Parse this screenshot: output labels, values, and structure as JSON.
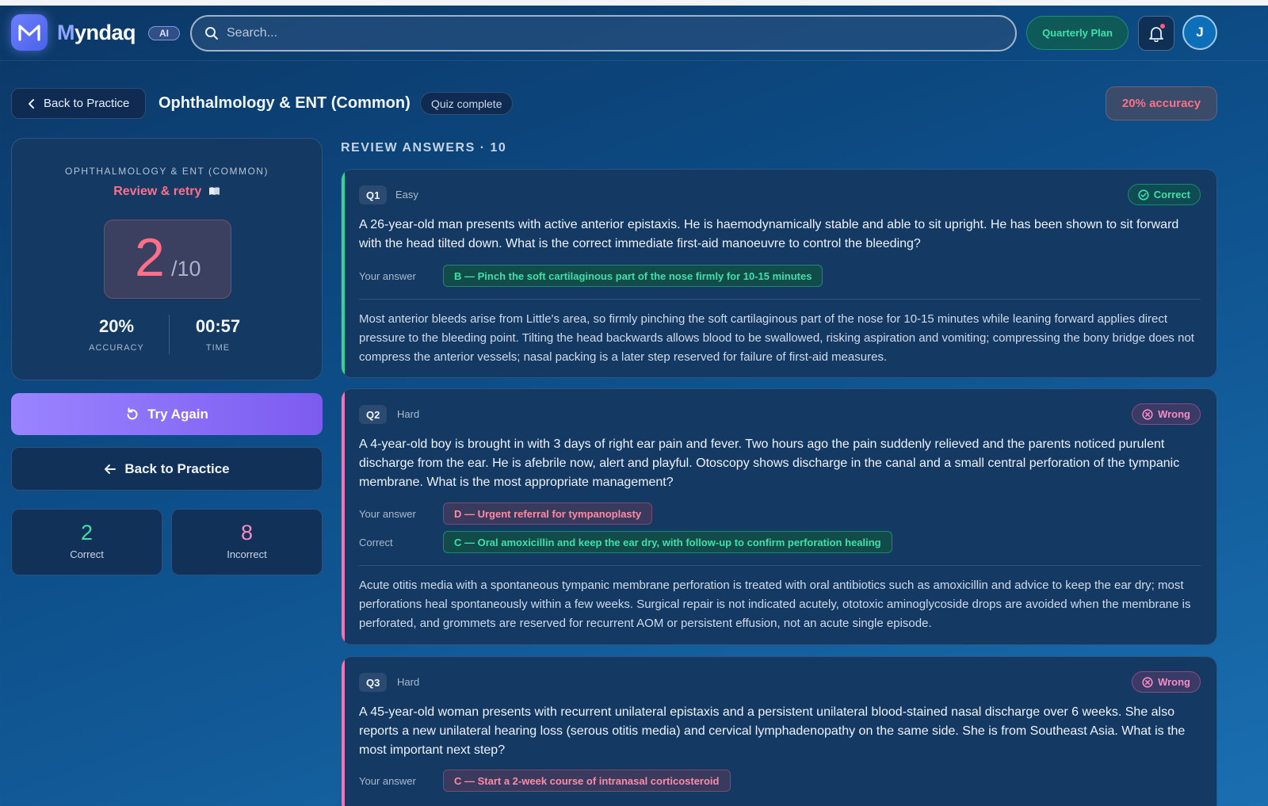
{
  "header": {
    "brand_first": "M",
    "brand_rest": "yndaq",
    "ai_badge": "AI",
    "search_placeholder": "Search...",
    "plan_label": "Quarterly Plan",
    "avatar_initial": "J"
  },
  "subheader": {
    "back_label": "Back to Practice",
    "title": "Ophthalmology & ENT (Common)",
    "status_badge": "Quiz complete",
    "accuracy_badge": "20% accuracy"
  },
  "score_card": {
    "category": "OPHTHALMOLOGY & ENT (COMMON)",
    "subtitle": "Review & retry",
    "score": "2",
    "total": "/10",
    "accuracy_value": "20%",
    "accuracy_label": "ACCURACY",
    "time_value": "00:57",
    "time_label": "TIME"
  },
  "actions": {
    "try_again": "Try Again",
    "back_to_practice": "Back to Practice"
  },
  "tallies": {
    "correct_value": "2",
    "correct_label": "Correct",
    "incorrect_value": "8",
    "incorrect_label": "Incorrect"
  },
  "review": {
    "heading": "REVIEW ANSWERS · 10",
    "your_answer_label": "Your answer",
    "correct_label": "Correct",
    "questions": [
      {
        "num": "Q1",
        "difficulty": "Easy",
        "status": "Correct",
        "text": "A 26-year-old man presents with active anterior epistaxis. He is haemodynamically stable and able to sit upright. He has been shown to sit forward with the head tilted down. What is the correct immediate first-aid manoeuvre to control the bleeding?",
        "your_answer": "B — Pinch the soft cartilaginous part of the nose firmly for 10-15 minutes",
        "explanation": "Most anterior bleeds arise from Little's area, so firmly pinching the soft cartilaginous part of the nose for 10-15 minutes while leaning forward applies direct pressure to the bleeding point. Tilting the head backwards allows blood to be swallowed, risking aspiration and vomiting; compressing the bony bridge does not compress the anterior vessels; nasal packing is a later step reserved for failure of first-aid measures."
      },
      {
        "num": "Q2",
        "difficulty": "Hard",
        "status": "Wrong",
        "text": "A 4-year-old boy is brought in with 3 days of right ear pain and fever. Two hours ago the pain suddenly relieved and the parents noticed purulent discharge from the ear. He is afebrile now, alert and playful. Otoscopy shows discharge in the canal and a small central perforation of the tympanic membrane. What is the most appropriate management?",
        "your_answer": "D — Urgent referral for tympanoplasty",
        "correct_answer": "C — Oral amoxicillin and keep the ear dry, with follow-up to confirm perforation healing",
        "explanation": "Acute otitis media with a spontaneous tympanic membrane perforation is treated with oral antibiotics such as amoxicillin and advice to keep the ear dry; most perforations heal spontaneously within a few weeks. Surgical repair is not indicated acutely, ototoxic aminoglycoside drops are avoided when the membrane is perforated, and grommets are reserved for recurrent AOM or persistent effusion, not an acute single episode."
      },
      {
        "num": "Q3",
        "difficulty": "Hard",
        "status": "Wrong",
        "text": "A 45-year-old woman presents with recurrent unilateral epistaxis and a persistent unilateral blood-stained nasal discharge over 6 weeks. She also reports a new unilateral hearing loss (serous otitis media) and cervical lymphadenopathy on the same side. She is from Southeast Asia. What is the most important next step?",
        "your_answer": "C — Start a 2-week course of intranasal corticosteroid"
      }
    ]
  },
  "colors": {
    "accent_purple": "#7c5cf0",
    "correct_green": "#3fe0a6",
    "wrong_pink": "#ff6f87"
  }
}
